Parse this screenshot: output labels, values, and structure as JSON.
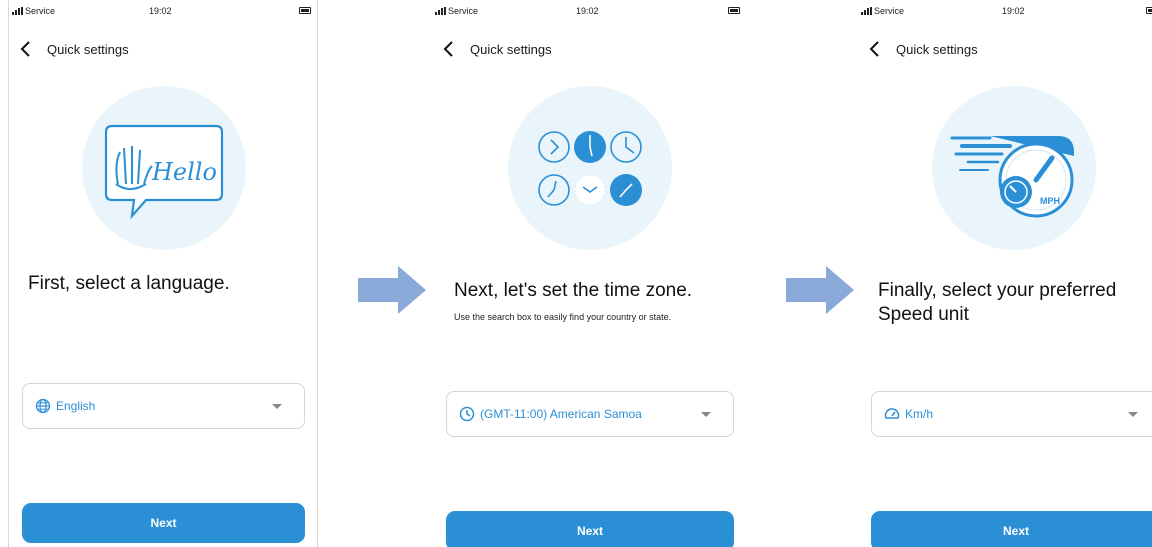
{
  "colors": {
    "accent": "#2b8fd6",
    "arrow": "#8aa8d8",
    "illustration_bg": "#eaf4fb"
  },
  "status_bar": {
    "carrier": "Service",
    "time": "19:02"
  },
  "screens": [
    {
      "nav_title": "Quick settings",
      "illustration": "hello-wave-illustration",
      "illustration_text": "Hello",
      "heading": "First, select a language.",
      "hint": "",
      "select": {
        "icon": "globe-icon",
        "value": "English"
      },
      "next_label": "Next"
    },
    {
      "nav_title": "Quick settings",
      "illustration": "clocks-illustration",
      "heading": "Next, let's set the time zone.",
      "hint": "Use the search box to easily find your country or state.",
      "select": {
        "icon": "clock-icon",
        "value": "(GMT-11:00) American Samoa"
      },
      "next_label": "Next"
    },
    {
      "nav_title": "Quick settings",
      "illustration": "speedometer-illustration",
      "illustration_text": "MPH",
      "heading": "Finally, select your preferred Speed unit",
      "hint": "",
      "select": {
        "icon": "speedometer-icon",
        "value": "Km/h"
      },
      "next_label": "Next"
    }
  ],
  "flow_arrows": [
    "right-arrow-icon",
    "right-arrow-icon"
  ]
}
